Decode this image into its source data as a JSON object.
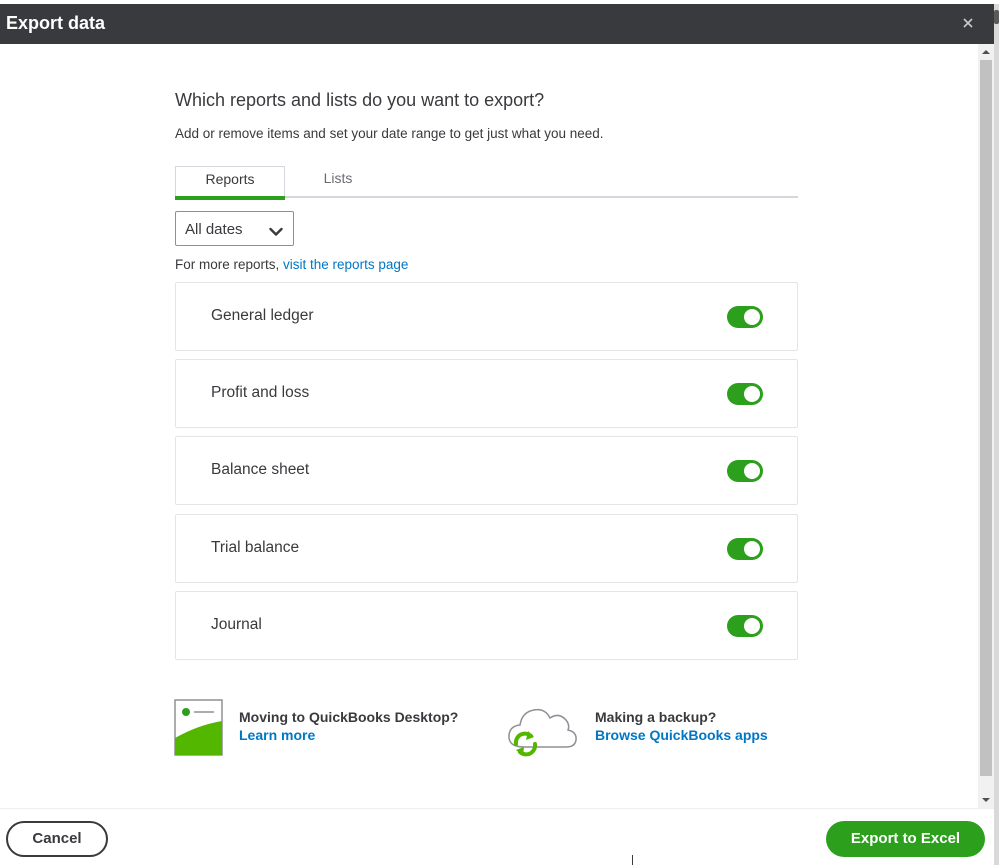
{
  "dialog": {
    "title": "Export data",
    "close_icon": "close-icon"
  },
  "main": {
    "heading": "Which reports and lists do you want to export?",
    "subheading": "Add or remove items and set your date range to get just what you need.",
    "tabs": [
      {
        "label": "Reports",
        "active": true
      },
      {
        "label": "Lists",
        "active": false
      }
    ],
    "date_filter": {
      "value": "All dates",
      "icon": "chevron-down-icon"
    },
    "more_reports": {
      "prefix": "For more reports, ",
      "link": "visit the reports page"
    },
    "reports": [
      {
        "label": "General ledger",
        "enabled": true
      },
      {
        "label": "Profit and loss",
        "enabled": true
      },
      {
        "label": "Balance sheet",
        "enabled": true
      },
      {
        "label": "Trial balance",
        "enabled": true
      },
      {
        "label": "Journal",
        "enabled": true
      }
    ]
  },
  "promos": [
    {
      "title": "Moving to QuickBooks Desktop?",
      "link": "Learn more",
      "icon": "desktop-window-icon"
    },
    {
      "title": "Making a backup?",
      "link": "Browse QuickBooks apps",
      "icon": "cloud-sync-icon"
    }
  ],
  "footer": {
    "cancel_label": "Cancel",
    "export_label": "Export to Excel"
  },
  "colors": {
    "accent_green": "#2ca01c",
    "link_blue": "#0077c5",
    "title_bar": "#393a3d"
  }
}
